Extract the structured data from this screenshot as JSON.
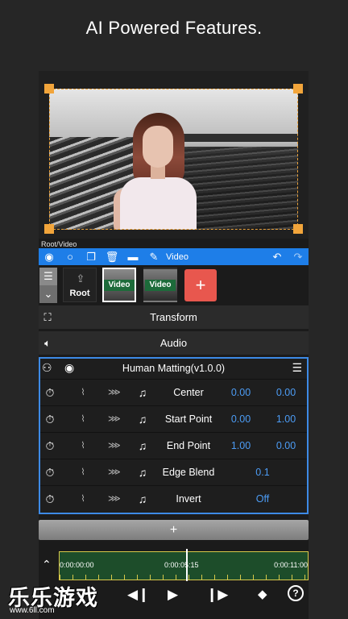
{
  "headline": "AI Powered Features.",
  "preview": {
    "path_label": "Root/Video"
  },
  "toolbar": {
    "icons": [
      "eye-icon",
      "circle-icon",
      "copy-icon",
      "trash-icon",
      "folder-icon",
      "pencil-icon",
      "undo-icon",
      "redo-icon"
    ],
    "layer_label": "Video"
  },
  "layers": {
    "root_label": "Root",
    "video_1_label": "Video",
    "video_2_label": "Video",
    "add_symbol": "+"
  },
  "sections": {
    "transform": "Transform",
    "audio": "Audio"
  },
  "effect": {
    "name": "Human Matting(v1.0.0)",
    "params": [
      {
        "label": "Center",
        "v1": "0.00",
        "v2": "0.00"
      },
      {
        "label": "Start Point",
        "v1": "0.00",
        "v2": "1.00"
      },
      {
        "label": "End Point",
        "v1": "1.00",
        "v2": "0.00"
      },
      {
        "label": "Edge Blend",
        "value": "0.1"
      },
      {
        "label": "Invert",
        "value": "Off"
      }
    ]
  },
  "add_effect": "+",
  "timeline": {
    "t_start": "0:00:00:00",
    "t_current": "0:00:05:15",
    "t_end": "0:00:11:00"
  },
  "watermark": {
    "text": "乐乐游戏",
    "url": "www.6ll.com"
  },
  "colors": {
    "accent": "#1e7ee8",
    "value_blue": "#4c9cf5",
    "add_red": "#e8574e",
    "handle_orange": "#f2a53b"
  }
}
